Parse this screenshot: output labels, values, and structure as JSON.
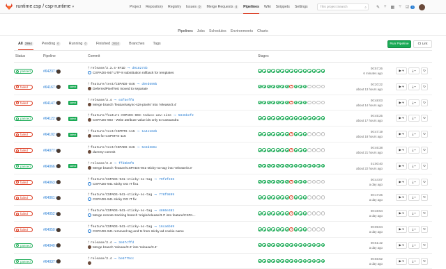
{
  "header": {
    "project_path": "runtime.csp / csp-runtime",
    "search_placeholder": "This project  Search",
    "nav": [
      {
        "label": "Project",
        "count": ""
      },
      {
        "label": "Repository",
        "count": ""
      },
      {
        "label": "Registry",
        "count": ""
      },
      {
        "label": "Issues",
        "count": "0"
      },
      {
        "label": "Merge Requests",
        "count": "4"
      },
      {
        "label": "Pipelines",
        "count": ""
      },
      {
        "label": "Wiki",
        "count": ""
      },
      {
        "label": "Snippets",
        "count": ""
      },
      {
        "label": "Settings",
        "count": ""
      }
    ],
    "todo_count": "2"
  },
  "subnav": [
    "Pipelines",
    "Jobs",
    "Schedules",
    "Environments",
    "Charts"
  ],
  "tabs": [
    {
      "label": "All",
      "count": "2864"
    },
    {
      "label": "Pending",
      "count": "0"
    },
    {
      "label": "Running",
      "count": "0"
    },
    {
      "label": "Finished",
      "count": "2810"
    },
    {
      "label": "Branches",
      "count": ""
    },
    {
      "label": "Tags",
      "count": ""
    }
  ],
  "buttons": {
    "run_pipeline": "Run Pipeline",
    "ci_lint": "CI Lint"
  },
  "table_headers": {
    "status": "Status",
    "pipeline": "Pipeline",
    "commit": "Commit",
    "stages": "Stages"
  },
  "colors": {
    "passed": "#1aaa55",
    "failed": "#db3b21",
    "link": "#1f78d1",
    "accent": "#db3b21"
  },
  "pipelines": [
    {
      "status": "passed",
      "id": "#64237 by",
      "latest": false,
      "ref": "release/3.3.4-HF1D",
      "sha": "d918273b",
      "message": "CSPADS-947 UTF-8 substitution rollback for templates",
      "msg_icon": "jira",
      "stages": "sssssssssssssss",
      "duration": "00:57:26",
      "finished": "6 minutes ago"
    },
    {
      "status": "failed",
      "id": "#64167 by",
      "latest": true,
      "ref": "feature/test/CSPADS-846",
      "sha": "d9ed699b",
      "message": "DeferredPixelTest moved to separate",
      "msg_icon": "avatar",
      "stages": "sssssssfssskkkk",
      "duration": "00:20:22",
      "finished": "about 13 hours ago"
    },
    {
      "status": "failed",
      "id": "#64147 by",
      "latest": true,
      "ref": "release/3.4",
      "sha": "e3f5eff8",
      "message": "Merge branch 'feature/async-s2s-pixels' into 'release/3.4'",
      "msg_icon": "avatar",
      "stages": "sssssssfssskkkk",
      "duration": "00:48:03",
      "finished": "about 14 hours ago"
    },
    {
      "status": "passed",
      "id": "#64122 by",
      "latest": true,
      "ref": "feature/feature-CSPADS-903-reduce-aev-size",
      "sha": "5846bef2",
      "message": "CSPADS-903 - Write attribute value ids only to Cassandra",
      "msg_icon": "avatar",
      "stages": "sssssssssssssss",
      "duration": "00:45:25",
      "finished": "about 17 hours ago"
    },
    {
      "status": "failed",
      "id": "#64102 by",
      "latest": true,
      "ref": "feature/test/CSPMTS-115",
      "sha": "1a4e162b",
      "message": "tests for CSPMTS-115",
      "msg_icon": "avatar",
      "stages": "sssssssfssskkkk",
      "duration": "00:47:19",
      "finished": "about 18 hours ago"
    },
    {
      "status": "failed",
      "id": "#64077 by",
      "latest": false,
      "ref": "feature/test/CSPADS-846",
      "sha": "5e8d386c",
      "message": "dummy commit",
      "msg_icon": "avatar",
      "stages": "sssssssfssskkkk",
      "duration": "00:46:38",
      "finished": "about 21 hours ago"
    },
    {
      "status": "passed",
      "id": "#64066 by",
      "latest": true,
      "ref": "release/3.3",
      "sha": "ffd8b5f6",
      "message": "Merge branch 'feature/CSPADS-941-sticky-no-tag' into 'release/3.3'",
      "msg_icon": "avatar",
      "stages": "sssssssssssssss",
      "duration": "01:00:40",
      "finished": "about 22 hours ago"
    },
    {
      "status": "failed",
      "id": "#64063 by",
      "latest": false,
      "ref": "feature/CSPADS-941-sticky-no-tag",
      "sha": "79f2f236",
      "message": "CSPADS-941 sticky OG IT fix1",
      "msg_icon": "jira",
      "stages": "sssssssfssskkkk",
      "duration": "00:44:07",
      "finished": "a day ago"
    },
    {
      "status": "failed",
      "id": "#64061 by",
      "latest": false,
      "ref": "feature/CSPADS-941-sticky-no-tag",
      "sha": "778f9899",
      "message": "CSPADS-941 sticky OG IT fix",
      "msg_icon": "jira",
      "stages": "sssssssfssskkkk",
      "duration": "00:17:26",
      "finished": "a day ago"
    },
    {
      "status": "failed",
      "id": "#64052 by",
      "latest": false,
      "ref": "feature/CSPADS-941-sticky-no-tag",
      "sha": "4866e381",
      "message": "Merge remote-tracking branch 'origin/release/3.3' into feature/CSPA...",
      "msg_icon": "jira",
      "stages": "sssssssfssskkkk",
      "duration": "00:48:54",
      "finished": "a day ago"
    },
    {
      "status": "failed",
      "id": "#64050 by",
      "latest": false,
      "ref": "feature/CSPADS-941-sticky-no-tag",
      "sha": "16ca6b69",
      "message": "CSPADS-941 removed tag and ts from sticky ad cookie name",
      "msg_icon": "jira",
      "stages": "sssssssfssskkkk",
      "duration": "00:05:04",
      "finished": "a day ago"
    },
    {
      "status": "passed",
      "id": "#64040 by",
      "latest": false,
      "ref": "release/3.4",
      "sha": "3e67cffd",
      "message": "Merge branch 'release/3.3' into 'release/3.4'",
      "msg_icon": "avatar",
      "stages": "sssssssssssssss",
      "duration": "00:51:42",
      "finished": "a day ago"
    },
    {
      "status": "passed",
      "id": "#64037 by",
      "latest": false,
      "ref": "release/3.4",
      "sha": "be6775cc",
      "message": "",
      "msg_icon": "avatar",
      "stages": "sssssssssssssss",
      "duration": "00:55:52",
      "finished": "a day ago"
    }
  ]
}
